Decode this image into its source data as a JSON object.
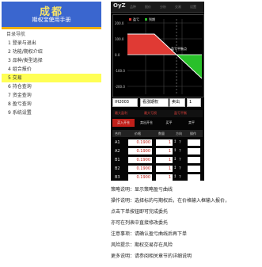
{
  "sidebar": {
    "banner_title": "成都",
    "banner_subtitle": "期权宝使用手册",
    "toc_title": "目录导航",
    "items": [
      "1 登录与退出",
      "2 功能/期权介绍",
      "3 品种/类型选择",
      "4 组合报价",
      "5 交易",
      "6 持仓查询",
      "7 资金查询",
      "8 盈亏查询",
      "9 系统设置"
    ],
    "active_index": 4
  },
  "phone": {
    "brand": "OyZ",
    "top_tabs": [
      "品种",
      "报价",
      "分析",
      "交易",
      "设置"
    ],
    "chart": {
      "y_labels": [
        "200.0",
        "100.0",
        "0.0",
        "-100.0",
        "-200.0"
      ],
      "legend": [
        "盈亏",
        "到期"
      ],
      "annotation": "盈亏平衡点",
      "colors": {
        "loss": "#e03a34",
        "profit": "#29c02a",
        "grid": "#444444",
        "line": "#ffffff"
      }
    },
    "selectors": [
      "IH2003",
      "看涨期权",
      "卖出",
      "1"
    ],
    "info_row": [
      "最大盈利",
      "最大亏损",
      "盈亏平衡"
    ],
    "tabs": [
      "买入开仓",
      "卖出开仓",
      "买平",
      "卖平"
    ],
    "grid_header": [
      "合约",
      "价格",
      "数量",
      "方向",
      "操作"
    ],
    "rows": [
      {
        "label": "A1",
        "price": "0.1900",
        "qty": "1"
      },
      {
        "label": "A2",
        "price": "0.1900",
        "qty": "1"
      },
      {
        "label": "B1",
        "price": "0.1900",
        "qty": "1"
      },
      {
        "label": "B2",
        "price": "0.1900",
        "qty": "1"
      },
      {
        "label": "B3",
        "price": "0.1900",
        "qty": "1"
      }
    ]
  },
  "notes": [
    "策略说明：显示策略盈亏曲线",
    "操作说明：选择标的与期权后，在价格输入框输入报价，",
    "                  点击下单按钮即可完成委托",
    "                  亦可在列表中直接修改委托",
    "注意事项：请确认盈亏曲线后再下单",
    "风险提示：期权交易存在风险",
    "更多说明：请参阅相关章节的详细说明"
  ]
}
